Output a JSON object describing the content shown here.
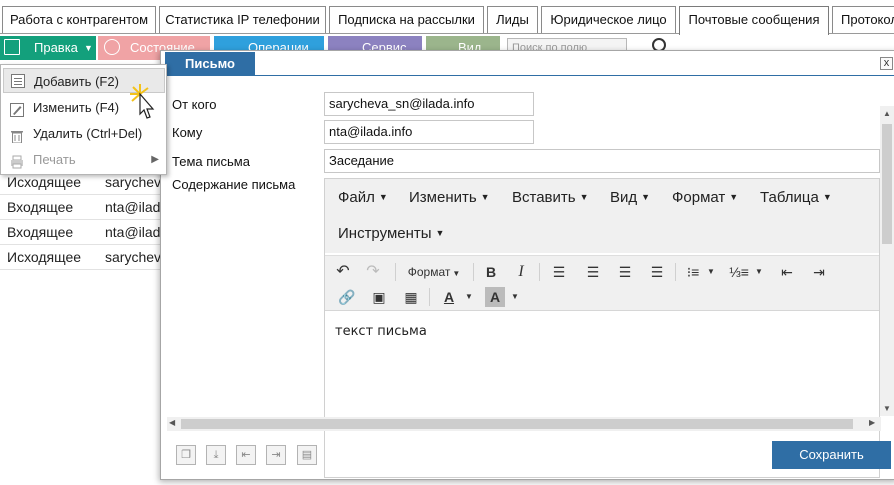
{
  "tabs": [
    {
      "label": "Работа с контрагентом"
    },
    {
      "label": "Статистика IP телефонии"
    },
    {
      "label": "Подписка на рассылки"
    },
    {
      "label": "Лиды"
    },
    {
      "label": "Юридическое лицо"
    },
    {
      "label": "Почтовые сообщения"
    },
    {
      "label": "Протокол"
    }
  ],
  "toolbar": {
    "pravka": "Правка",
    "sostoyanie": "Состояние",
    "operacii": "Операции",
    "servis": "Сервис",
    "vid": "Вид",
    "search_placeholder": "Поиск по полю"
  },
  "menu": {
    "items": [
      {
        "label": "Добавить (F2)"
      },
      {
        "label": "Изменить (F4)"
      },
      {
        "label": "Удалить (Ctrl+Del)"
      },
      {
        "label": "Печать"
      }
    ]
  },
  "table": {
    "rows": [
      {
        "type": "Исходящее",
        "addr": "sarycheva"
      },
      {
        "type": "Входящее",
        "addr": "nta@ilada"
      },
      {
        "type": "Входящее",
        "addr": "nta@ilada"
      },
      {
        "type": "Исходящее",
        "addr": "sarycheva"
      }
    ]
  },
  "dialog": {
    "title": "Письмо",
    "close": "x",
    "from_label": "От кого",
    "from_value": "sarycheva_sn@ilada.info",
    "to_label": "Кому",
    "to_value": "nta@ilada.info",
    "subject_label": "Тема письма",
    "subject_value": "Заседание",
    "body_label": "Содержание письма",
    "save_label": "Сохранить"
  },
  "editor": {
    "menu": [
      "Файл",
      "Изменить",
      "Вставить",
      "Вид",
      "Формат",
      "Таблица",
      "Инструменты"
    ],
    "format_label": "Формат",
    "content": "текст письма"
  },
  "colors": {
    "accent": "#2f6ea5",
    "pravka": "#13a07c",
    "sostoyanie": "#f0a3a5",
    "operacii": "#2fa0dd",
    "servis": "#8c82c0",
    "vid": "#9bb58c"
  }
}
